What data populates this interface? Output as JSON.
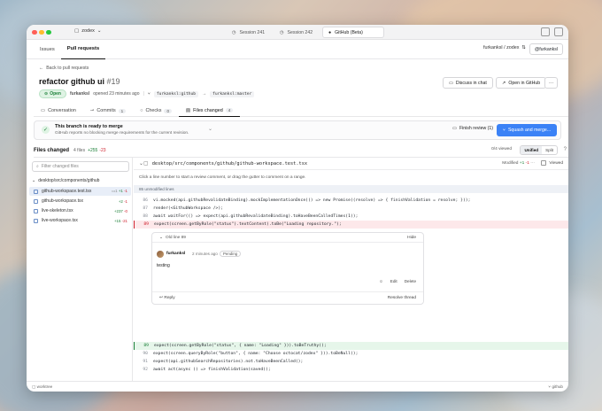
{
  "window": {
    "workspace": "zodex",
    "tabs": [
      {
        "label": "Session 241",
        "active": false
      },
      {
        "label": "Session 242",
        "active": false
      },
      {
        "label": "GitHub (Beta)",
        "active": true
      }
    ]
  },
  "subnav": {
    "tabs": [
      {
        "label": "Issues"
      },
      {
        "label": "Pull requests"
      }
    ],
    "repo": "furkanksl / zodex",
    "user": "@furkanksl"
  },
  "pr": {
    "back": "Back to pull requests",
    "title": "refactor github ui",
    "number": "#19",
    "status": "Open",
    "author": "furkanksl",
    "opened": "opened 23 minutes ago",
    "head_branch": "furkanksl:github",
    "base_branch": "furkanksl:master",
    "discuss": "Discuss in chat",
    "open_github": "Open in GitHub",
    "more": "···",
    "arrow": "→"
  },
  "prtabs": [
    {
      "label": "Conversation",
      "count": ""
    },
    {
      "label": "Commits",
      "count": "1"
    },
    {
      "label": "Checks",
      "count": "0"
    },
    {
      "label": "Files changed",
      "count": "4"
    }
  ],
  "merge": {
    "title": "This branch is ready to merge",
    "subtitle": "GitHub reports no blocking merge requirements for the current revision.",
    "finish": "Finish review (1)",
    "squash": "Squash and merge..."
  },
  "files_changed": {
    "title": "Files changed",
    "files": "4 files",
    "additions": "+255",
    "deletions": "-23",
    "viewed": "0/4 viewed",
    "unified": "Unified",
    "split": "Split"
  },
  "sidebar": {
    "filter_placeholder": "Filter changed files",
    "dir": "desktop/src/components/github",
    "files": [
      {
        "name": "github-workspace.test.tsx",
        "add": "+1",
        "del": "-1",
        "selected": true
      },
      {
        "name": "github-workspace.tsx",
        "add": "+2",
        "del": "-1",
        "selected": false
      },
      {
        "name": "live-skeleton.tsx",
        "add": "+237",
        "del": "-0",
        "selected": false
      },
      {
        "name": "live-workspace.tsx",
        "add": "+15",
        "del": "-21",
        "selected": false
      }
    ]
  },
  "diff": {
    "path": "desktop/src/components/github/github-workspace.test.tsx",
    "modified": "Modified",
    "mod_add": "+1",
    "mod_del": "-1",
    "viewed": "Viewed",
    "hint": "Click a line number to start a review comment, or drag the gutter to comment on a range.",
    "unmodified": "85 unmodified lines",
    "lines_top": [
      {
        "n": "86",
        "t": "vi.mocked(api.githubRevalidateBinding).mockImplementationOnce(() => new Promise((resolve) => { finishValidation = resolve; }));",
        "kind": ""
      },
      {
        "n": "87",
        "t": "render(<GithubWorkspace />);",
        "kind": ""
      },
      {
        "n": "88",
        "t": "await waitFor(() => expect(api.githubRevalidateBinding).toHaveBeenCalledTimes(1));",
        "kind": ""
      },
      {
        "n": "89",
        "t": "expect(screen.getByRole(\"status\").textContent).toBe(\"Loading repository.\");",
        "kind": "del"
      }
    ],
    "lines_bottom": [
      {
        "n": "89",
        "t": "expect(screen.getByRole(\"status\", { name: \"Loading\" })).toBeTruthy();",
        "kind": "add"
      },
      {
        "n": "90",
        "t": "expect(screen.queryByRole(\"button\", { name: \"Choose octocat/zodex\" })).toBeNull();",
        "kind": ""
      },
      {
        "n": "91",
        "t": "expect(api.githubSearchRepositories).not.toHaveBeenCalled();",
        "kind": ""
      },
      {
        "n": "92",
        "t": "await act(async () => finishValidation(saved));",
        "kind": ""
      }
    ]
  },
  "thread": {
    "head": "Old line 89",
    "hide": "Hide",
    "author": "furkanksl",
    "time": "2 minutes ago",
    "pending": "Pending",
    "body": "testing",
    "edit": "Edit",
    "delete": "Delete",
    "reply": "Reply",
    "resolve": "Resolve thread"
  },
  "statusbar": {
    "left": "worktree",
    "right": "github"
  },
  "colors": {
    "accent": "#3b82f6",
    "add": "#1a7f37",
    "del": "#cf222e",
    "open": "#1a7f37"
  }
}
